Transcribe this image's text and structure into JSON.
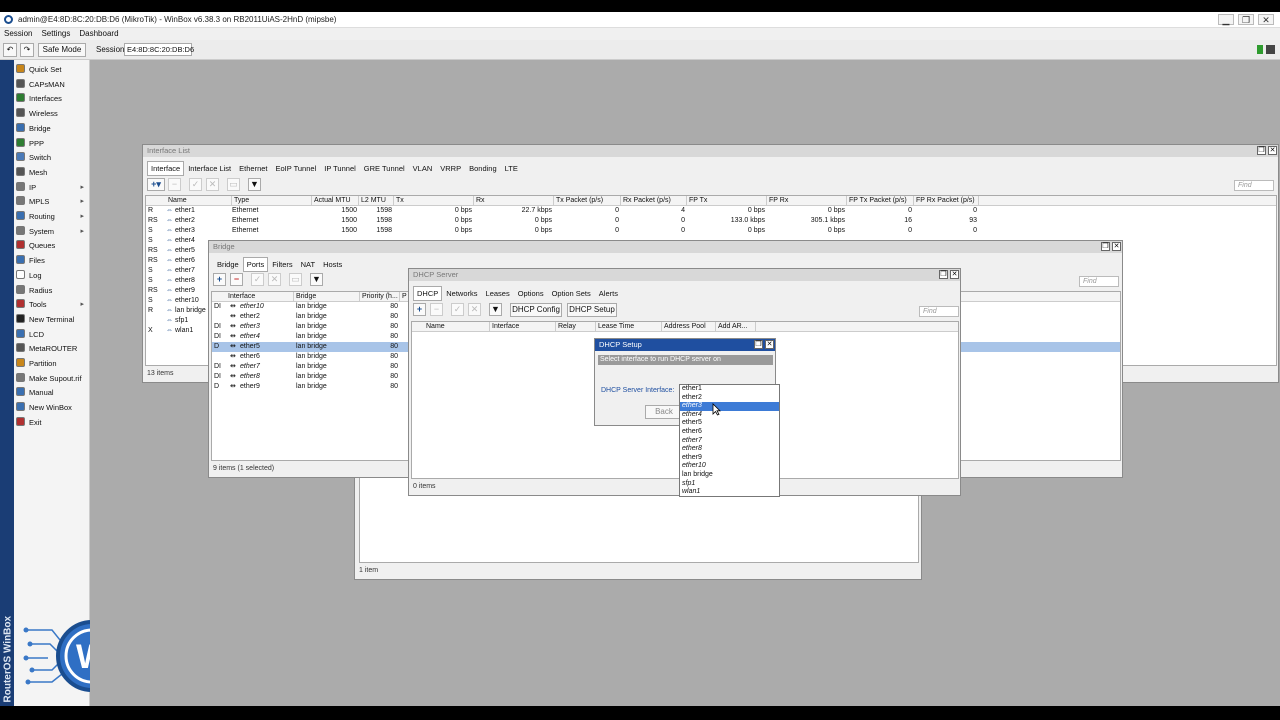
{
  "window": {
    "title": "admin@E4:8D:8C:20:DB:D6 (MikroTik) - WinBox v6.38.3 on RB2011UiAS-2HnD (mipsbe)",
    "min": "▁",
    "max": "❐",
    "close": "✕"
  },
  "menu": [
    "Session",
    "Settings",
    "Dashboard"
  ],
  "toolbar": {
    "undo": "↶",
    "redo": "↷",
    "safe_mode": "Safe Mode",
    "session_label": "Session:",
    "session_value": "E4:8D:8C:20:DB:D6"
  },
  "brand_vertical": "RouterOS WinBox",
  "sidebar": [
    {
      "label": "Quick Set",
      "icon": "quickset-icon",
      "color": "#c8861a",
      "arrow": ""
    },
    {
      "label": "CAPsMAN",
      "icon": "capsman-icon",
      "color": "#555555",
      "arrow": ""
    },
    {
      "label": "Interfaces",
      "icon": "interfaces-icon",
      "color": "#2e7d32",
      "arrow": ""
    },
    {
      "label": "Wireless",
      "icon": "wireless-icon",
      "color": "#555555",
      "arrow": ""
    },
    {
      "label": "Bridge",
      "icon": "bridge-icon",
      "color": "#3a6fb0",
      "arrow": ""
    },
    {
      "label": "PPP",
      "icon": "ppp-icon",
      "color": "#2e7d32",
      "arrow": ""
    },
    {
      "label": "Switch",
      "icon": "switch-icon",
      "color": "#4a7ab8",
      "arrow": ""
    },
    {
      "label": "Mesh",
      "icon": "mesh-icon",
      "color": "#555555",
      "arrow": ""
    },
    {
      "label": "IP",
      "icon": "ip-icon",
      "color": "#777777",
      "arrow": "▸"
    },
    {
      "label": "MPLS",
      "icon": "mpls-icon",
      "color": "#777777",
      "arrow": "▸"
    },
    {
      "label": "Routing",
      "icon": "routing-icon",
      "color": "#3a6fb0",
      "arrow": "▸"
    },
    {
      "label": "System",
      "icon": "system-icon",
      "color": "#777777",
      "arrow": "▸"
    },
    {
      "label": "Queues",
      "icon": "queues-icon",
      "color": "#b03030",
      "arrow": ""
    },
    {
      "label": "Files",
      "icon": "files-icon",
      "color": "#3a6fb0",
      "arrow": ""
    },
    {
      "label": "Log",
      "icon": "log-icon",
      "color": "#ffffff",
      "arrow": ""
    },
    {
      "label": "Radius",
      "icon": "radius-icon",
      "color": "#777777",
      "arrow": ""
    },
    {
      "label": "Tools",
      "icon": "tools-icon",
      "color": "#b03030",
      "arrow": "▸"
    },
    {
      "label": "New Terminal",
      "icon": "terminal-icon",
      "color": "#222222",
      "arrow": ""
    },
    {
      "label": "LCD",
      "icon": "lcd-icon",
      "color": "#3a6fb0",
      "arrow": ""
    },
    {
      "label": "MetaROUTER",
      "icon": "metarouter-icon",
      "color": "#555555",
      "arrow": ""
    },
    {
      "label": "Partition",
      "icon": "partition-icon",
      "color": "#c8861a",
      "arrow": ""
    },
    {
      "label": "Make Supout.rif",
      "icon": "supout-icon",
      "color": "#777777",
      "arrow": ""
    },
    {
      "label": "Manual",
      "icon": "manual-icon",
      "color": "#3a6fb0",
      "arrow": ""
    },
    {
      "label": "New WinBox",
      "icon": "winbox-icon",
      "color": "#3a6fb0",
      "arrow": ""
    },
    {
      "label": "Exit",
      "icon": "exit-icon",
      "color": "#b03030",
      "arrow": ""
    }
  ],
  "interface_list": {
    "title": "Interface List",
    "tabs": [
      "Interface",
      "Interface List",
      "Ethernet",
      "EoIP Tunnel",
      "IP Tunnel",
      "GRE Tunnel",
      "VLAN",
      "VRRP",
      "Bonding",
      "LTE"
    ],
    "find": "Find",
    "columns": [
      "Name",
      "Type",
      "Actual MTU",
      "L2 MTU",
      "Tx",
      "Rx",
      "Tx Packet (p/s)",
      "Rx Packet (p/s)",
      "FP Tx",
      "FP Rx",
      "FP Tx Packet (p/s)",
      "FP Rx Packet (p/s)"
    ],
    "rows": [
      {
        "flag": "R",
        "name": "ether1",
        "type": "Ethernet",
        "mtu": "1500",
        "l2": "1598",
        "tx": "0 bps",
        "rx": "22.7 kbps",
        "txp": "0",
        "rxp": "4",
        "fptx": "0 bps",
        "fprx": "0 bps",
        "fptxp": "0",
        "fprxp": "0"
      },
      {
        "flag": "RS",
        "name": "ether2",
        "type": "Ethernet",
        "mtu": "1500",
        "l2": "1598",
        "tx": "0 bps",
        "rx": "0 bps",
        "txp": "0",
        "rxp": "0",
        "fptx": "133.0 kbps",
        "fprx": "305.1 kbps",
        "fptxp": "16",
        "fprxp": "93"
      },
      {
        "flag": "S",
        "name": "ether3",
        "type": "Ethernet",
        "mtu": "1500",
        "l2": "1598",
        "tx": "0 bps",
        "rx": "0 bps",
        "txp": "0",
        "rxp": "0",
        "fptx": "0 bps",
        "fprx": "0 bps",
        "fptxp": "0",
        "fprxp": "0"
      },
      {
        "flag": "S",
        "name": "ether4"
      },
      {
        "flag": "RS",
        "name": "ether5"
      },
      {
        "flag": "RS",
        "name": "ether6"
      },
      {
        "flag": "S",
        "name": "ether7"
      },
      {
        "flag": "S",
        "name": "ether8"
      },
      {
        "flag": "RS",
        "name": "ether9"
      },
      {
        "flag": "S",
        "name": "ether10"
      },
      {
        "flag": "R",
        "name": "lan bridge"
      },
      {
        "flag": "",
        "name": "sfp1"
      },
      {
        "flag": "X",
        "name": "wlan1"
      }
    ],
    "status": "13 items"
  },
  "bridge": {
    "title": "Bridge",
    "tabs": [
      "Bridge",
      "Ports",
      "Filters",
      "NAT",
      "Hosts"
    ],
    "columns": [
      "Interface",
      "Bridge",
      "Priority (h...",
      "P"
    ],
    "rows": [
      {
        "flag": "DI",
        "iface": "ether10",
        "bridge": "lan bridge",
        "prio": "80",
        "sel": false,
        "ital": true
      },
      {
        "flag": "",
        "iface": "ether2",
        "bridge": "lan bridge",
        "prio": "80",
        "sel": false,
        "ital": false
      },
      {
        "flag": "DI",
        "iface": "ether3",
        "bridge": "lan bridge",
        "prio": "80",
        "sel": false,
        "ital": true
      },
      {
        "flag": "DI",
        "iface": "ether4",
        "bridge": "lan bridge",
        "prio": "80",
        "sel": false,
        "ital": true
      },
      {
        "flag": "D",
        "iface": "ether5",
        "bridge": "lan bridge",
        "prio": "80",
        "sel": true,
        "ital": false
      },
      {
        "flag": "",
        "iface": "ether6",
        "bridge": "lan bridge",
        "prio": "80",
        "sel": false,
        "ital": false
      },
      {
        "flag": "DI",
        "iface": "ether7",
        "bridge": "lan bridge",
        "prio": "80",
        "sel": false,
        "ital": true
      },
      {
        "flag": "DI",
        "iface": "ether8",
        "bridge": "lan bridge",
        "prio": "80",
        "sel": false,
        "ital": true
      },
      {
        "flag": "D",
        "iface": "ether9",
        "bridge": "lan bridge",
        "prio": "80",
        "sel": false,
        "ital": false
      }
    ],
    "status": "9 items (1 selected)",
    "find": "Find"
  },
  "back_window": {
    "status": "1 item"
  },
  "dhcp_server": {
    "title": "DHCP Server",
    "tabs": [
      "DHCP",
      "Networks",
      "Leases",
      "Options",
      "Option Sets",
      "Alerts"
    ],
    "buttons": [
      "DHCP Config",
      "DHCP Setup"
    ],
    "find": "Find",
    "columns": [
      "Name",
      "Interface",
      "Relay",
      "Lease Time",
      "Address Pool",
      "Add AR..."
    ],
    "status": "0 items"
  },
  "dhcp_setup": {
    "title": "DHCP Setup",
    "prompt": "Select interface to run DHCP server on",
    "label": "DHCP Server Interface:",
    "value": "sfp1",
    "back": "Back",
    "options": [
      {
        "text": "ether1",
        "hl": false,
        "ital": false
      },
      {
        "text": "ether2",
        "hl": false,
        "ital": false
      },
      {
        "text": "ether3",
        "hl": true,
        "ital": true
      },
      {
        "text": "ether4",
        "hl": false,
        "ital": true
      },
      {
        "text": "ether5",
        "hl": false,
        "ital": false
      },
      {
        "text": "ether6",
        "hl": false,
        "ital": false
      },
      {
        "text": "ether7",
        "hl": false,
        "ital": true
      },
      {
        "text": "ether8",
        "hl": false,
        "ital": true
      },
      {
        "text": "ether9",
        "hl": false,
        "ital": false
      },
      {
        "text": "ether10",
        "hl": false,
        "ital": true
      },
      {
        "text": "lan bridge",
        "hl": false,
        "ital": false
      },
      {
        "text": "sfp1",
        "hl": false,
        "ital": true
      },
      {
        "text": "wlan1",
        "hl": false,
        "ital": true
      }
    ]
  }
}
